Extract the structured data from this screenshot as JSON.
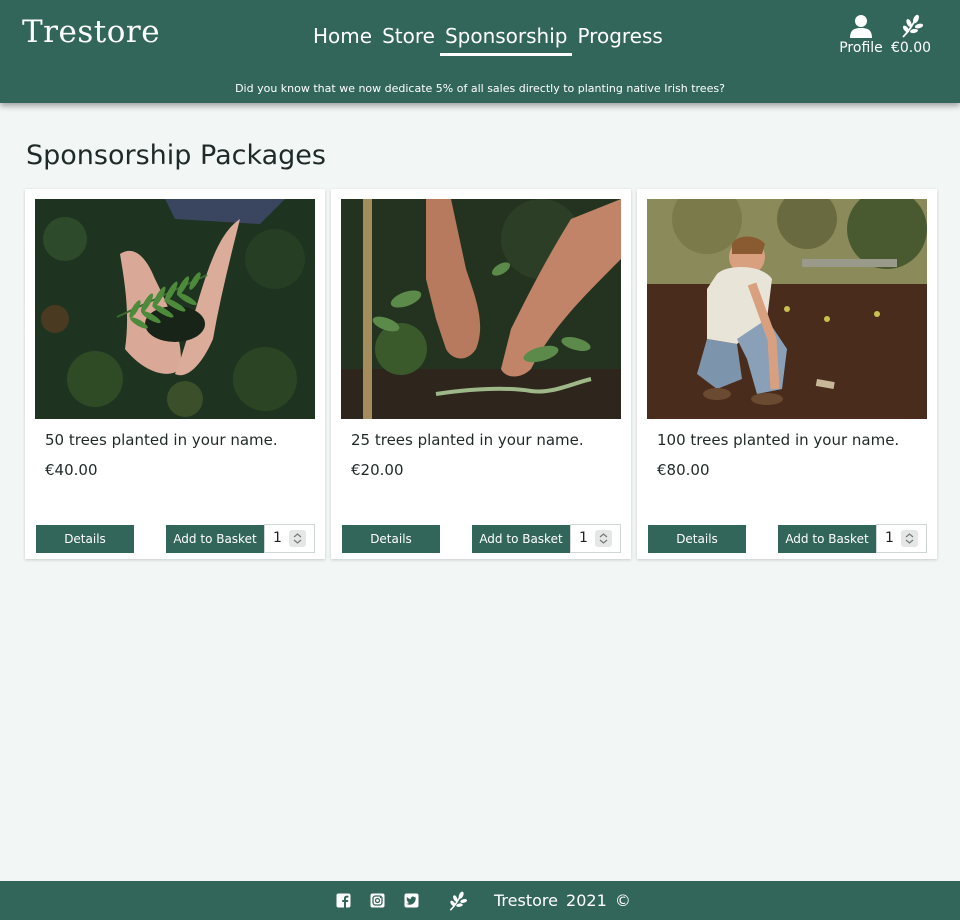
{
  "header": {
    "brand": "Trestore",
    "nav": [
      {
        "label": "Home",
        "active": false
      },
      {
        "label": "Store",
        "active": false
      },
      {
        "label": "Sponsorship",
        "active": true
      },
      {
        "label": "Progress",
        "active": false
      }
    ],
    "profile_label": "Profile",
    "profile_icon": "user-icon",
    "basket_total": "€0.00",
    "basket_icon": "leaf-icon",
    "banner": "Did you know that we now dedicate 5% of all sales directly to planting native Irish trees?"
  },
  "main": {
    "title": "Sponsorship Packages",
    "packages": [
      {
        "title": "50 trees planted in your name.",
        "price": "€40.00",
        "details_label": "Details",
        "add_label": "Add to Basket",
        "quantity": "1"
      },
      {
        "title": "25 trees planted in your name.",
        "price": "€20.00",
        "details_label": "Details",
        "add_label": "Add to Basket",
        "quantity": "1"
      },
      {
        "title": "100 trees planted in your name.",
        "price": "€80.00",
        "details_label": "Details",
        "add_label": "Add to Basket",
        "quantity": "1"
      }
    ]
  },
  "footer": {
    "text": "Trestore  2021  ©",
    "icons": [
      "facebook-icon",
      "instagram-icon",
      "twitter-icon",
      "leaf-icon"
    ]
  },
  "colors": {
    "brand_green": "#33665a",
    "page_background": "#f2f7f6",
    "card_background": "#ffffff"
  }
}
